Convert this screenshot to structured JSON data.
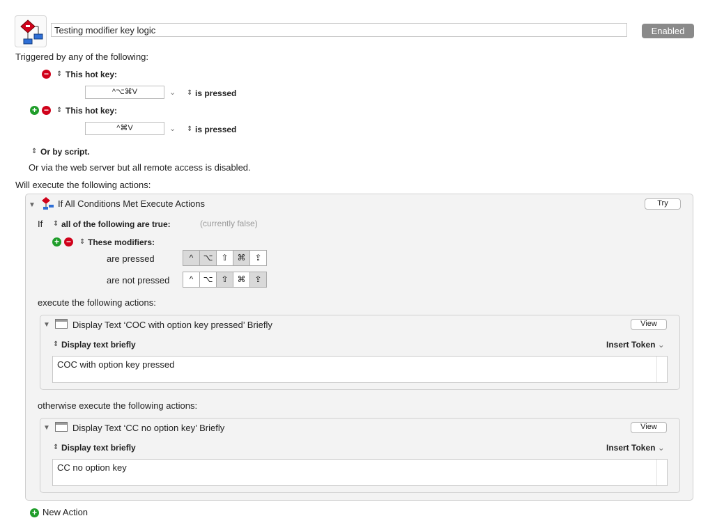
{
  "macro": {
    "name": "Testing modifier key logic",
    "status_button": "Enabled"
  },
  "triggers": {
    "heading": "Triggered by any of the following:",
    "items": [
      {
        "label": "This hot key:",
        "key": "^⌥⌘V",
        "condition": "is pressed"
      },
      {
        "label": "This hot key:",
        "key": "^⌘V",
        "condition": "is pressed"
      }
    ],
    "script": "Or by script.",
    "web": "Or via the web server but all remote access is disabled."
  },
  "actions": {
    "heading": "Will execute the following actions:",
    "if_block": {
      "title": "If All Conditions Met Execute Actions",
      "try_label": "Try",
      "if_label": "If",
      "condition_select": "all of the following are true:",
      "condition_state": "(currently false)",
      "modifiers_label": "These modifiers:",
      "pressed_label": "are pressed",
      "not_pressed_label": "are not pressed",
      "modifier_keys": [
        "^",
        "⌥",
        "⇧",
        "⌘",
        "⇪"
      ],
      "pressed_active": [
        true,
        true,
        false,
        true,
        false
      ],
      "not_pressed_active": [
        false,
        false,
        true,
        false,
        true
      ],
      "then_label": "execute the following actions:",
      "else_label": "otherwise execute the following actions:"
    },
    "then_action": {
      "title": "Display Text ‘COC with option key pressed’ Briefly",
      "view_label": "View",
      "mode": "Display text briefly",
      "insert_token": "Insert Token",
      "text": "COC with option key pressed"
    },
    "else_action": {
      "title": "Display Text ‘CC  no option key’ Briefly",
      "view_label": "View",
      "mode": "Display text briefly",
      "insert_token": "Insert Token",
      "text": "CC  no option key"
    },
    "new_action": "New Action"
  }
}
